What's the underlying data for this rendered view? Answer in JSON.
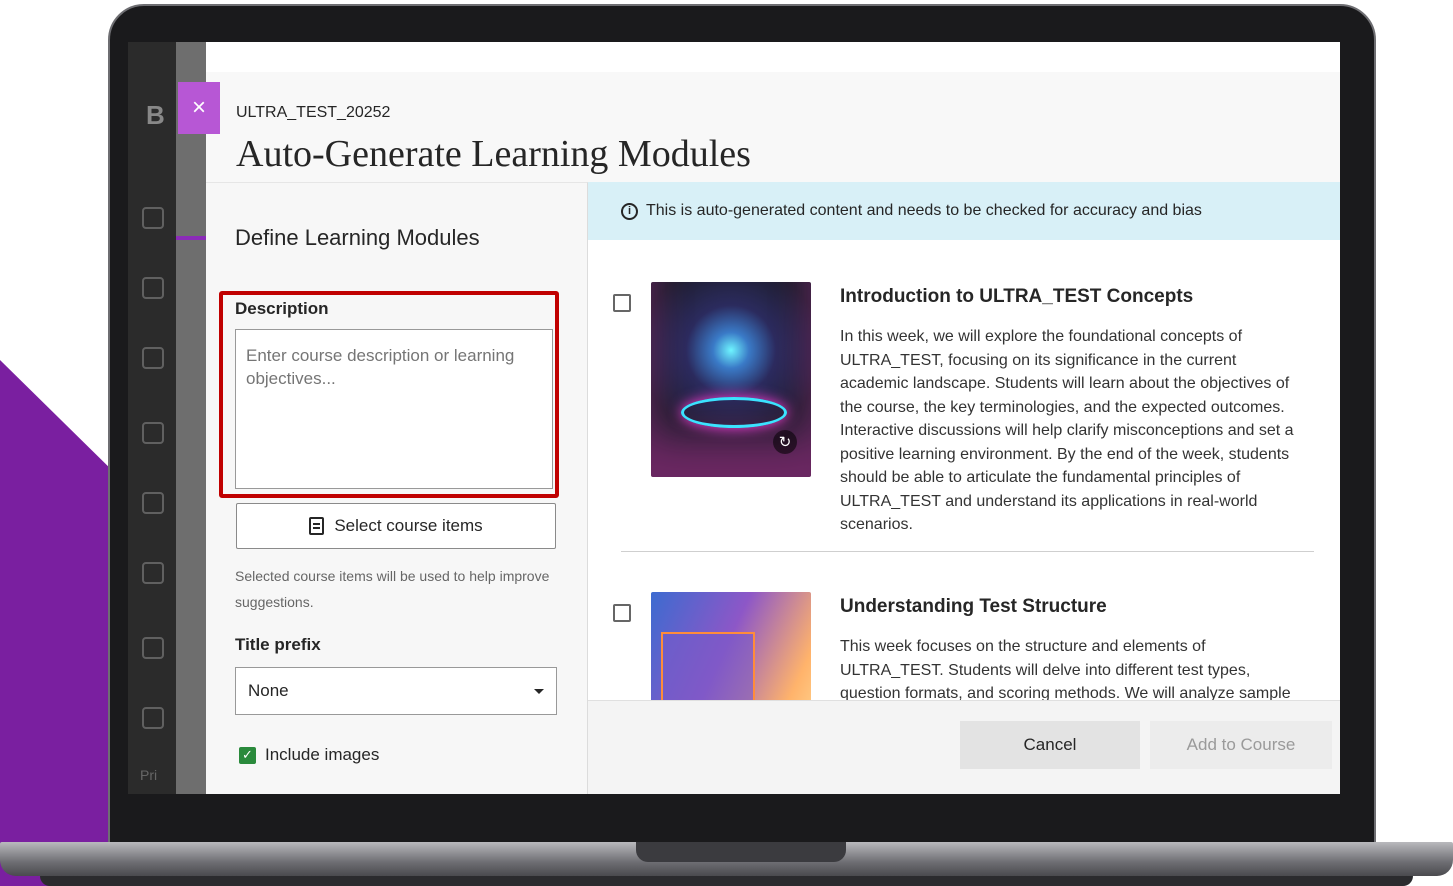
{
  "modal": {
    "course_code": "ULTRA_TEST_20252",
    "title": "Auto-Generate Learning Modules",
    "close_label": "×"
  },
  "left_pane": {
    "section_title": "Define Learning Modules",
    "description_label": "Description",
    "description_placeholder": "Enter course description or learning objectives...",
    "description_value": "",
    "select_items_label": "Select course items",
    "helper_text": "Selected course items will be used to help improve suggestions.",
    "title_prefix_label": "Title prefix",
    "title_prefix_value": "None",
    "include_images_label": "Include images",
    "include_images_checked": true
  },
  "right_pane": {
    "notice": "This is auto-generated content and needs to be checked for accuracy and bias",
    "modules": [
      {
        "title": "Introduction to ULTRA_TEST Concepts",
        "description": "In this week, we will explore the foundational concepts of ULTRA_TEST, focusing on its significance in the current academic landscape. Students will learn about the objectives of the course, the key terminologies, and the expected outcomes. Interactive discussions will help clarify misconceptions and set a positive learning environment. By the end of the week, students should be able to articulate the fundamental principles of ULTRA_TEST and understand its applications in real-world scenarios.",
        "checked": false
      },
      {
        "title": "Understanding Test Structure",
        "description": "This week focuses on the structure and elements of ULTRA_TEST. Students will delve into different test types, question formats, and scoring methods. We will analyze sample tests to identify critical",
        "checked": false
      }
    ]
  },
  "footer": {
    "cancel_label": "Cancel",
    "add_label": "Add to Course"
  },
  "background_app": {
    "logo_text": "B",
    "pri_text": "Pri"
  },
  "colors": {
    "accent_purple": "#b757d5",
    "brand_purple": "#7a1fa0",
    "highlight_red": "#c00000",
    "notice_bg": "#d8f0f7",
    "check_green": "#2a8a3c"
  },
  "icons": [
    "close-icon",
    "document-icon",
    "info-icon",
    "caret-down-icon",
    "refresh-icon",
    "checkmark-icon"
  ]
}
